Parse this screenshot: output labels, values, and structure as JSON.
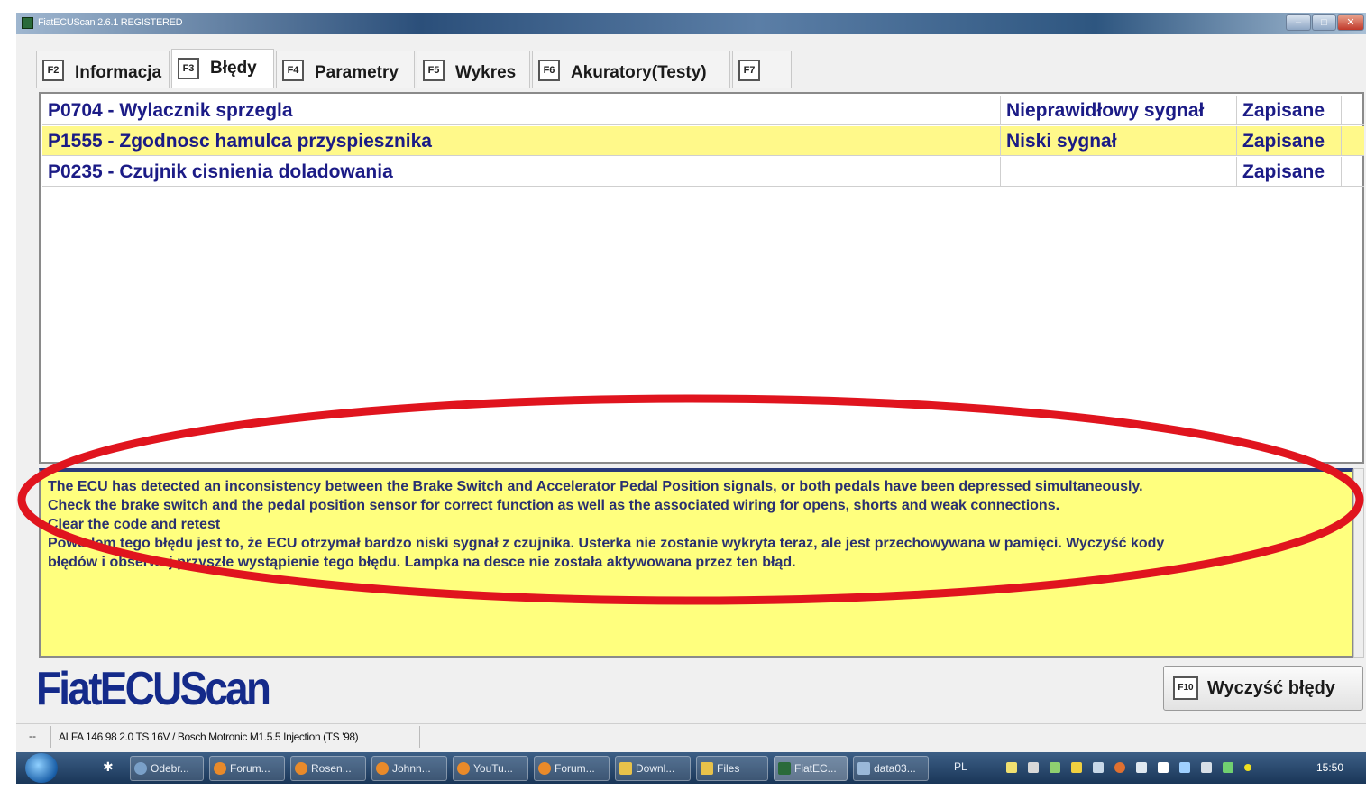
{
  "window": {
    "title": "FiatECUScan 2.6.1 REGISTERED"
  },
  "tabs": [
    {
      "key": "F2",
      "label": "Informacja"
    },
    {
      "key": "F3",
      "label": "Błędy",
      "active": true
    },
    {
      "key": "F4",
      "label": "Parametry"
    },
    {
      "key": "F5",
      "label": "Wykres"
    },
    {
      "key": "F6",
      "label": "Akuratory(Testy)"
    },
    {
      "key": "F7",
      "label": ""
    }
  ],
  "dtc_table": {
    "rows": [
      {
        "code": "P0704 - Wylacznik sprzegla",
        "status": "Nieprawidłowy sygnał",
        "stored": "Zapisane"
      },
      {
        "code": "P1555 - Zgodnosc hamulca przyspiesznika",
        "status": "Niski sygnał",
        "stored": "Zapisane",
        "selected": true
      },
      {
        "code": "P0235 - Czujnik cisnienia doladowania",
        "status": "",
        "stored": "Zapisane"
      }
    ]
  },
  "description": {
    "lines": [
      "The ECU has detected an inconsistency between the Brake Switch and Accelerator Pedal Position signals, or both pedals have been depressed simultaneously.",
      "Check the brake switch and the pedal position sensor for correct function as well as the associated wiring for opens, shorts and weak connections.",
      "Clear the code and retest",
      "Powodem tego błędu jest to, że ECU otrzymał bardzo niski sygnał z czujnika. Usterka nie zostanie wykryta teraz, ale jest przechowywana w pamięci. Wyczyść kody",
      "błędów i obserwuj przyszłe wystąpienie tego błędu. Lampka na desce nie została aktywowana przez ten błąd."
    ]
  },
  "logo": "FiatECUScan",
  "clear_button": {
    "key": "F10",
    "label": "Wyczyść błędy"
  },
  "status_bar": {
    "indicator": "--",
    "vehicle": "ALFA 146 98 2.0 TS 16V / Bosch Motronic M1.5.5 Injection (TS '98)"
  },
  "taskbar": {
    "items": [
      "Odebr...",
      "Forum...",
      "Rosen...",
      "Johnn...",
      "YouTu...",
      "Forum...",
      "Downl...",
      "Files",
      "FiatEC...",
      "data03..."
    ],
    "language": "PL",
    "clock": "15:50"
  },
  "colors": {
    "selected_row": "#fff98a",
    "description_bg": "#ffff7e",
    "dtc_text": "#1b1b86",
    "logo": "#142a8a",
    "annotation": "#e0141e"
  }
}
